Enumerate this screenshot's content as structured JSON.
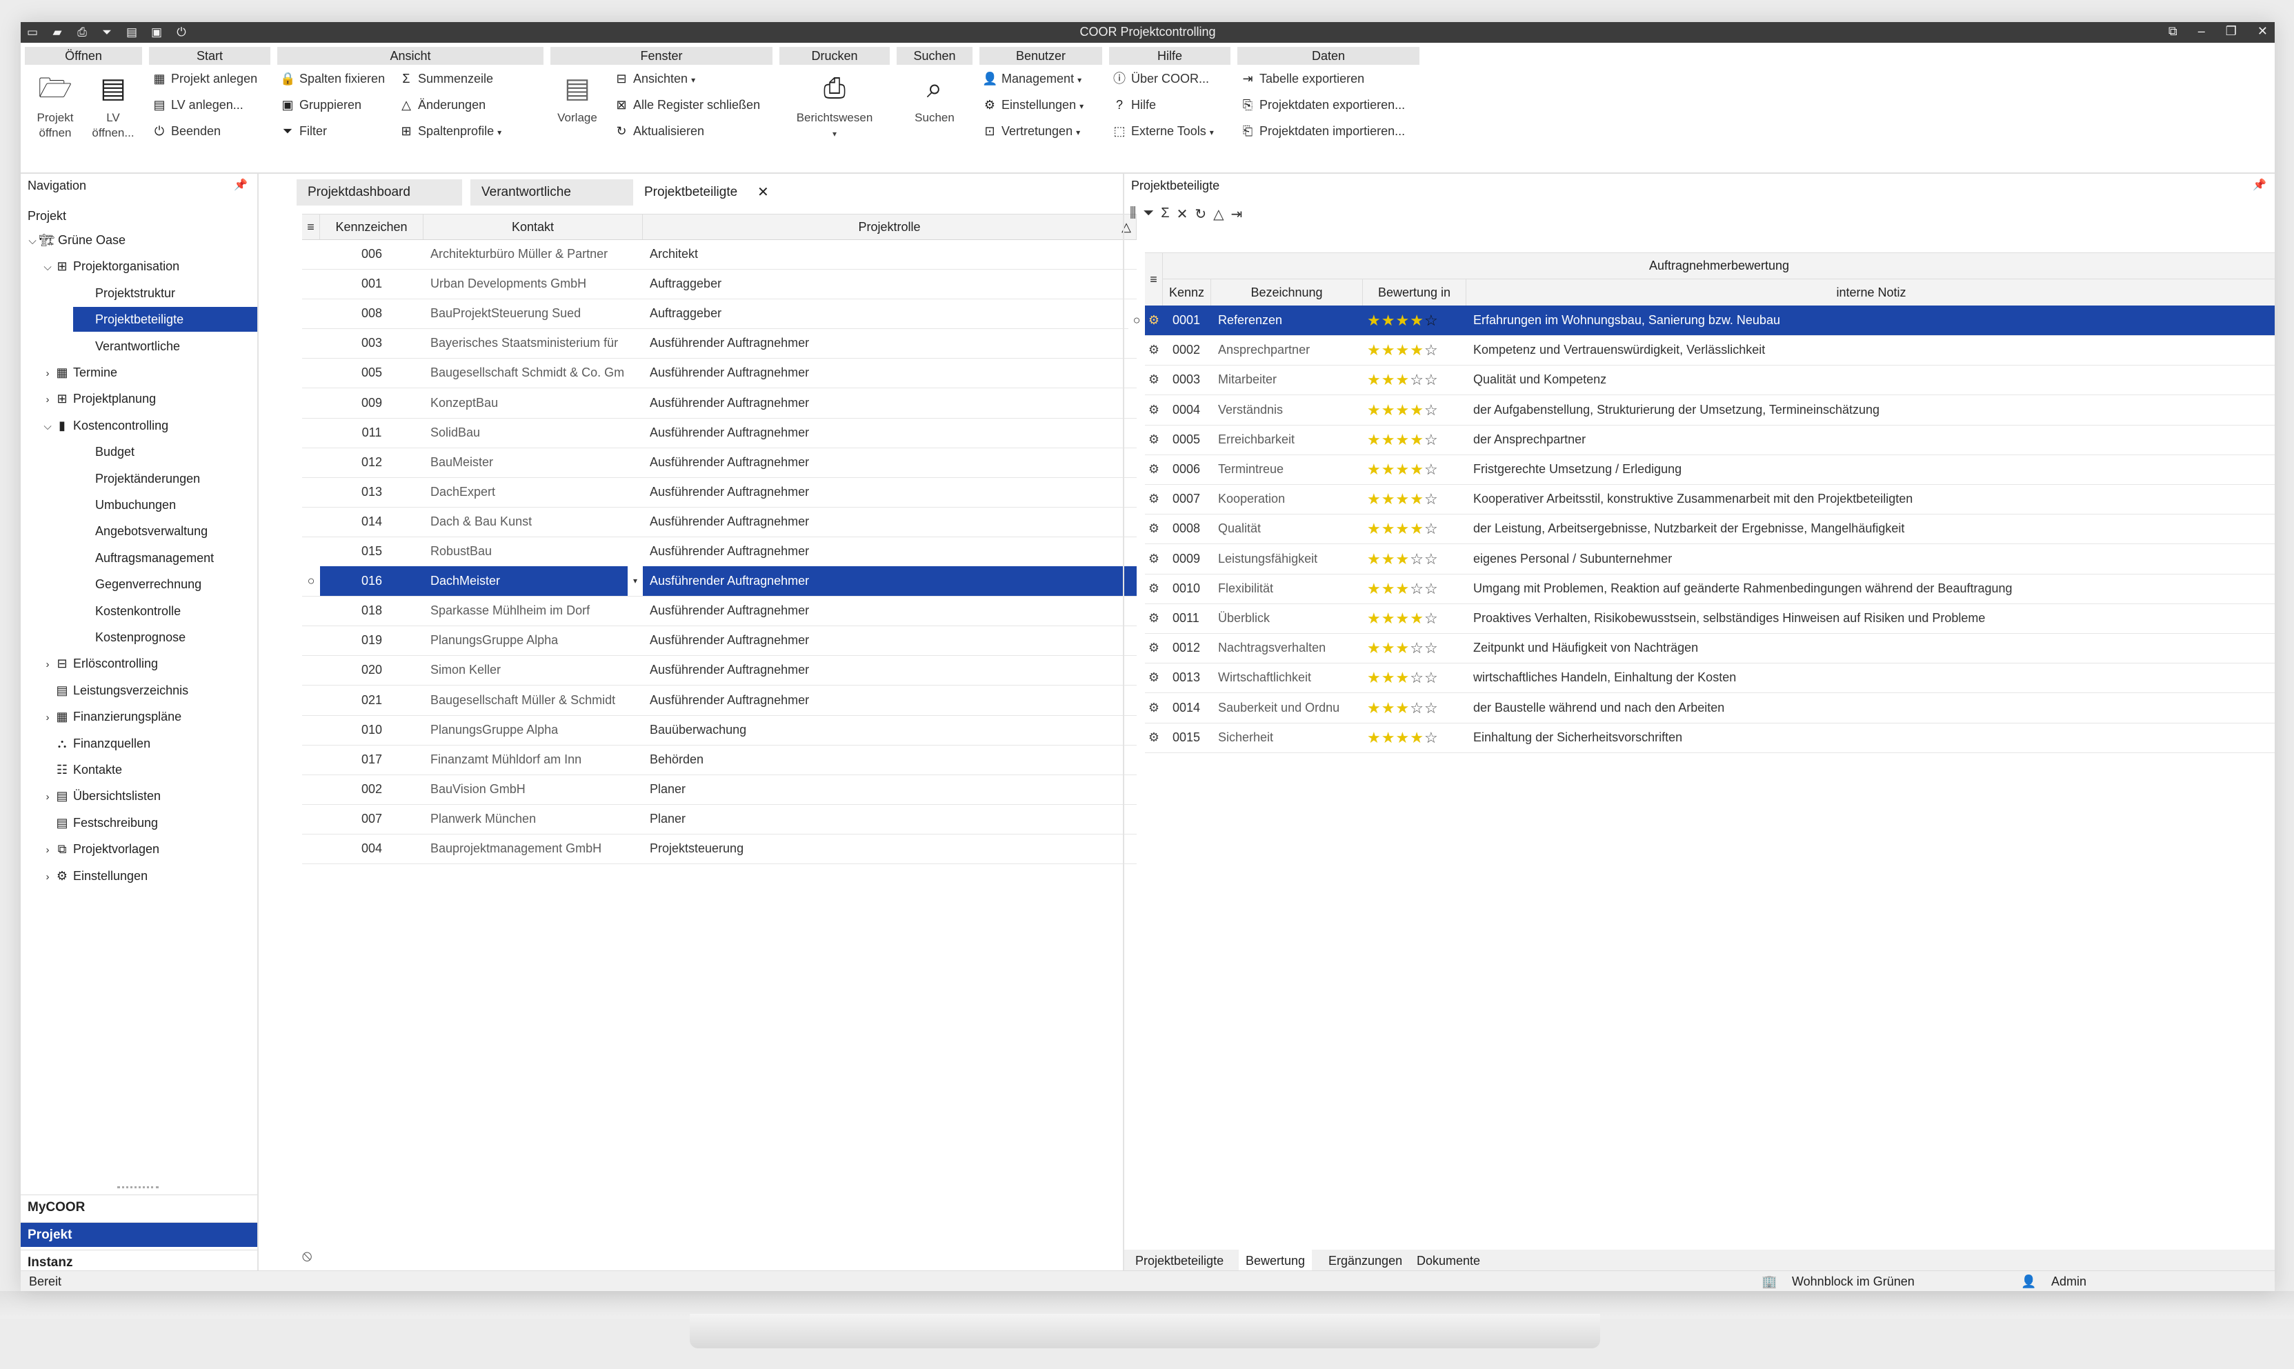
{
  "window": {
    "title": "COOR Projektcontrolling",
    "quick_access_icons": [
      "window-icon",
      "folder-open-icon",
      "print-icon",
      "filter-icon",
      "report-icon",
      "layout-icon",
      "power-icon"
    ],
    "controls": [
      "restore-icon",
      "minimize-icon",
      "maximize-icon",
      "close-icon"
    ]
  },
  "ribbon": {
    "groups": {
      "oeffnen": {
        "label": "Öffnen",
        "projekt": "Projekt öffnen",
        "lv": "LV öffnen..."
      },
      "start": {
        "label": "Start",
        "projekt_anlegen": "Projekt anlegen",
        "lv_anlegen": "LV anlegen...",
        "beenden": "Beenden"
      },
      "ansicht": {
        "label": "Ansicht",
        "spalten_fixieren": "Spalten fixieren",
        "gruppieren": "Gruppieren",
        "filter": "Filter",
        "summenzeile": "Summenzeile",
        "aenderungen": "Änderungen",
        "spaltenprofile": "Spaltenprofile"
      },
      "fenster": {
        "label": "Fenster",
        "vorlage": "Vorlage",
        "ansichten": "Ansichten",
        "alle_register": "Alle Register schließen",
        "aktualisieren": "Aktualisieren"
      },
      "drucken": {
        "label": "Drucken",
        "berichtswesen": "Berichtswesen"
      },
      "suchen": {
        "label": "Suchen",
        "suchen": "Suchen"
      },
      "benutzer": {
        "label": "Benutzer",
        "management": "Management",
        "einstellungen": "Einstellungen",
        "vertretungen": "Vertretungen"
      },
      "hilfe": {
        "label": "Hilfe",
        "ueber": "Über COOR...",
        "hilfe": "Hilfe",
        "externe_tools": "Externe Tools"
      },
      "daten": {
        "label": "Daten",
        "tabelle_exportieren": "Tabelle exportieren",
        "projektdaten_exportieren": "Projektdaten exportieren...",
        "projektdaten_importieren": "Projektdaten importieren..."
      }
    }
  },
  "nav": {
    "header": "Navigation",
    "section": "Projekt",
    "tree": [
      {
        "label": "Grüne Oase",
        "level": 0,
        "exp": "⌵",
        "icon": "project-tree-icon"
      },
      {
        "label": "Projektorganisation",
        "level": 1,
        "exp": "⌵",
        "icon": "organization-icon"
      },
      {
        "label": "Projektstruktur",
        "level": 2,
        "exp": "",
        "icon": ""
      },
      {
        "label": "Projektbeteiligte",
        "level": 2,
        "exp": "",
        "icon": "",
        "selected": true
      },
      {
        "label": "Verantwortliche",
        "level": 2,
        "exp": "",
        "icon": ""
      },
      {
        "label": "Termine",
        "level": 1,
        "exp": "›",
        "icon": "calendar-icon"
      },
      {
        "label": "Projektplanung",
        "level": 1,
        "exp": "›",
        "icon": "planning-icon"
      },
      {
        "label": "Kostencontrolling",
        "level": 1,
        "exp": "⌵",
        "icon": "bar-chart-icon"
      },
      {
        "label": "Budget",
        "level": 2,
        "exp": "",
        "icon": ""
      },
      {
        "label": "Projektänderungen",
        "level": 2,
        "exp": "",
        "icon": ""
      },
      {
        "label": "Umbuchungen",
        "level": 2,
        "exp": "",
        "icon": ""
      },
      {
        "label": "Angebotsverwaltung",
        "level": 2,
        "exp": "",
        "icon": ""
      },
      {
        "label": "Auftragsmanagement",
        "level": 2,
        "exp": "",
        "icon": ""
      },
      {
        "label": "Gegenverrechnung",
        "level": 2,
        "exp": "",
        "icon": ""
      },
      {
        "label": "Kostenkontrolle",
        "level": 2,
        "exp": "",
        "icon": ""
      },
      {
        "label": "Kostenprognose",
        "level": 2,
        "exp": "",
        "icon": ""
      },
      {
        "label": "Erlöscontrolling",
        "level": 1,
        "exp": "›",
        "icon": "revenue-icon"
      },
      {
        "label": "Leistungsverzeichnis",
        "level": 1,
        "exp": "",
        "icon": "list-icon"
      },
      {
        "label": "Finanzierungspläne",
        "level": 1,
        "exp": "›",
        "icon": "finance-plan-icon"
      },
      {
        "label": "Finanzquellen",
        "level": 1,
        "exp": "",
        "icon": "sources-icon"
      },
      {
        "label": "Kontakte",
        "level": 1,
        "exp": "",
        "icon": "contacts-icon"
      },
      {
        "label": "Übersichtslisten",
        "level": 1,
        "exp": "›",
        "icon": "overview-icon"
      },
      {
        "label": "Festschreibung",
        "level": 1,
        "exp": "",
        "icon": "lock-doc-icon"
      },
      {
        "label": "Projektvorlagen",
        "level": 1,
        "exp": "›",
        "icon": "template-icon"
      },
      {
        "label": "Einstellungen",
        "level": 1,
        "exp": "›",
        "icon": "gear-icon"
      }
    ],
    "bottom_tabs": [
      {
        "label": "MyCOOR",
        "selected": false
      },
      {
        "label": "Projekt",
        "selected": true
      },
      {
        "label": "Instanz",
        "selected": false
      }
    ]
  },
  "center": {
    "tabs": [
      {
        "label": "Projektdashboard",
        "active": false
      },
      {
        "label": "Verantwortliche",
        "active": false
      },
      {
        "label": "Projektbeteiligte",
        "active": true
      }
    ],
    "columns": [
      "Kennzeichen",
      "Kontakt",
      "Projektrolle"
    ],
    "rows": [
      {
        "kz": "006",
        "kontakt": "Architekturbüro Müller & Partner",
        "rolle": "Architekt"
      },
      {
        "kz": "001",
        "kontakt": "Urban Developments GmbH",
        "rolle": "Auftraggeber"
      },
      {
        "kz": "008",
        "kontakt": "BauProjektSteuerung Sued",
        "rolle": "Auftraggeber"
      },
      {
        "kz": "003",
        "kontakt": "Bayerisches Staatsministerium für",
        "rolle": "Ausführender Auftragnehmer"
      },
      {
        "kz": "005",
        "kontakt": "Baugesellschaft Schmidt & Co. Gm",
        "rolle": "Ausführender Auftragnehmer"
      },
      {
        "kz": "009",
        "kontakt": "KonzeptBau",
        "rolle": "Ausführender Auftragnehmer"
      },
      {
        "kz": "011",
        "kontakt": "SolidBau",
        "rolle": "Ausführender Auftragnehmer"
      },
      {
        "kz": "012",
        "kontakt": "BauMeister",
        "rolle": "Ausführender Auftragnehmer"
      },
      {
        "kz": "013",
        "kontakt": "DachExpert",
        "rolle": "Ausführender Auftragnehmer"
      },
      {
        "kz": "014",
        "kontakt": "Dach & Bau Kunst",
        "rolle": "Ausführender Auftragnehmer"
      },
      {
        "kz": "015",
        "kontakt": "RobustBau",
        "rolle": "Ausführender Auftragnehmer"
      },
      {
        "kz": "016",
        "kontakt": "DachMeister",
        "rolle": "Ausführender Auftragnehmer",
        "selected": true
      },
      {
        "kz": "018",
        "kontakt": "Sparkasse Mühlheim im Dorf",
        "rolle": "Ausführender Auftragnehmer"
      },
      {
        "kz": "019",
        "kontakt": "PlanungsGruppe Alpha",
        "rolle": "Ausführender Auftragnehmer"
      },
      {
        "kz": "020",
        "kontakt": "Simon Keller",
        "rolle": "Ausführender Auftragnehmer"
      },
      {
        "kz": "021",
        "kontakt": "Baugesellschaft Müller & Schmidt",
        "rolle": "Ausführender Auftragnehmer"
      },
      {
        "kz": "010",
        "kontakt": "PlanungsGruppe Alpha",
        "rolle": "Bauüberwachung"
      },
      {
        "kz": "017",
        "kontakt": "Finanzamt Mühldorf am Inn",
        "rolle": "Behörden"
      },
      {
        "kz": "002",
        "kontakt": "BauVision GmbH",
        "rolle": "Planer"
      },
      {
        "kz": "007",
        "kontakt": "Planwerk München",
        "rolle": "Planer"
      },
      {
        "kz": "004",
        "kontakt": "Bauprojektmanagement GmbH",
        "rolle": "Projektsteuerung"
      }
    ]
  },
  "right": {
    "header": "Projektbeteiligte",
    "toolbar_icons": [
      "columns-icon",
      "filter-icon",
      "sum-icon",
      "clear-icon",
      "refresh-icon",
      "change-icon",
      "export-icon"
    ],
    "group_header": "Auftragnehmerbewertung",
    "columns": [
      "Kennz",
      "Bezeichnung",
      "Bewertung in",
      "interne Notiz"
    ],
    "rows": [
      {
        "kz": "0001",
        "bez": "Referenzen",
        "rating": 4,
        "notiz": "Erfahrungen im Wohnungsbau, Sanierung bzw. Neubau",
        "selected": true
      },
      {
        "kz": "0002",
        "bez": "Ansprechpartner",
        "rating": 4,
        "notiz": "Kompetenz und Vertrauenswürdigkeit, Verlässlichkeit"
      },
      {
        "kz": "0003",
        "bez": "Mitarbeiter",
        "rating": 3,
        "notiz": "Qualität und Kompetenz"
      },
      {
        "kz": "0004",
        "bez": "Verständnis",
        "rating": 4,
        "notiz": "der Aufgabenstellung, Strukturierung der Umsetzung, Termineinschätzung"
      },
      {
        "kz": "0005",
        "bez": "Erreichbarkeit",
        "rating": 4,
        "notiz": "der Ansprechpartner"
      },
      {
        "kz": "0006",
        "bez": "Termintreue",
        "rating": 4,
        "notiz": "Fristgerechte Umsetzung / Erledigung"
      },
      {
        "kz": "0007",
        "bez": "Kooperation",
        "rating": 4,
        "notiz": "Kooperativer Arbeitsstil, konstruktive Zusammenarbeit mit den Projektbeteiligten"
      },
      {
        "kz": "0008",
        "bez": "Qualität",
        "rating": 4,
        "notiz": "der Leistung, Arbeitsergebnisse, Nutzbarkeit der Ergebnisse, Mangelhäufigkeit"
      },
      {
        "kz": "0009",
        "bez": "Leistungsfähigkeit",
        "rating": 3,
        "notiz": "eigenes Personal / Subunternehmer"
      },
      {
        "kz": "0010",
        "bez": "Flexibilität",
        "rating": 3,
        "notiz": "Umgang mit Problemen, Reaktion auf geänderte Rahmenbedingungen während der Beauftragung"
      },
      {
        "kz": "0011",
        "bez": "Überblick",
        "rating": 4,
        "notiz": "Proaktives Verhalten, Risikobewusstsein, selbständiges Hinweisen auf Risiken und Probleme"
      },
      {
        "kz": "0012",
        "bez": "Nachtragsverhalten",
        "rating": 3,
        "notiz": "Zeitpunkt und Häufigkeit von Nachträgen"
      },
      {
        "kz": "0013",
        "bez": "Wirtschaftlichkeit",
        "rating": 3,
        "notiz": "wirtschaftliches Handeln, Einhaltung der Kosten"
      },
      {
        "kz": "0014",
        "bez": "Sauberkeit und Ordnu",
        "rating": 3,
        "notiz": "der Baustelle während und nach den Arbeiten"
      },
      {
        "kz": "0015",
        "bez": "Sicherheit",
        "rating": 4,
        "notiz": "Einhaltung der Sicherheitsvorschriften"
      }
    ],
    "bottom_tabs": [
      {
        "label": "Projektbeteiligte",
        "active": false
      },
      {
        "label": "Bewertung",
        "active": true
      },
      {
        "label": "Ergänzungen",
        "active": false
      },
      {
        "label": "Dokumente",
        "active": false
      }
    ]
  },
  "status": {
    "text": "Bereit",
    "project": "Wohnblock im Grünen",
    "user": "Admin"
  },
  "colors": {
    "accent": "#1c46a8",
    "star": "#e8c400",
    "titlebar": "#3c3c3c"
  }
}
